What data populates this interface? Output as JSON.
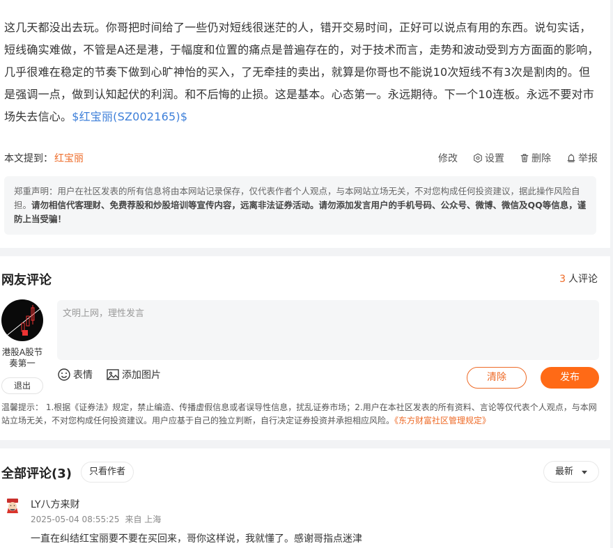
{
  "article": {
    "body": "这几天都没出去玩。你哥把时间给了一些仍对短线很迷茫的人，错开交易时间，正好可以说点有用的东西。说句实话，短线确实难做，不管是A还是港，于幅度和位置的痛点是普遍存在的，对于技术而言，走势和波动受到方方面面的影响，几乎很难在稳定的节奏下做到心旷神怡的买入，了无牵挂的卖出，就算是你哥也不能说10次短线不有3次是割肉的。但是强调一点，做到认知起伏的利润。和不后悔的止损。这是基本。心态第一。永远期待。下一个10连板。永远不要对市场失去信心。",
    "stock_link": "$红宝丽(SZ002165)$",
    "mention_label": "本文提到：",
    "mention_stock": "红宝丽",
    "actions": {
      "edit": "修改",
      "settings": "设置",
      "delete": "删除",
      "report": "举报"
    }
  },
  "disclaimer": {
    "normal": "郑重声明：用户在社区发表的所有信息将由本网站记录保存，仅代表作者个人观点，与本网站立场无关，不对您构成任何投资建议，据此操作风险自担。",
    "bold": "请勿相信代客理财、免费荐股和炒股培训等宣传内容，远离非法证券活动。请勿添加发言用户的手机号码、公众号、微博、微信及QQ等信息，谨防上当受骗！"
  },
  "comment_box": {
    "title": "网友评论",
    "count": "3",
    "count_label": "人评论",
    "user_name": "港股A股节奏第一",
    "logout": "退出",
    "placeholder": "文明上网，理性发言",
    "emoji": "表情",
    "add_image": "添加图片",
    "clear": "清除",
    "publish": "发布",
    "tip": "温馨提示：  1.根据《证券法》规定，禁止编造、传播虚假信息或者误导性信息，扰乱证券市场；2.用户在本社区发表的所有资料、言论等仅代表个人观点，与本网站立场无关，不对您构成任何投资建议。用户应基于自己的独立判断，自行决定证券投资并承担相应风险。",
    "rule_link": "《东方财富社区管理规定》"
  },
  "all_comments": {
    "title": "全部评论(3)",
    "author_only": "只看作者",
    "sort": "最新",
    "items": [
      {
        "name": "LY八方来财",
        "time": "2025-05-04 08:55:25",
        "location": "来自 上海",
        "text": "一直在纠结红宝丽要不要在买回来，哥你这样说，我就懂了。感谢哥指点迷津"
      }
    ]
  },
  "colors": {
    "accent": "#ee6a26",
    "publish": "#ff6a16",
    "link": "#3d7fd9"
  }
}
